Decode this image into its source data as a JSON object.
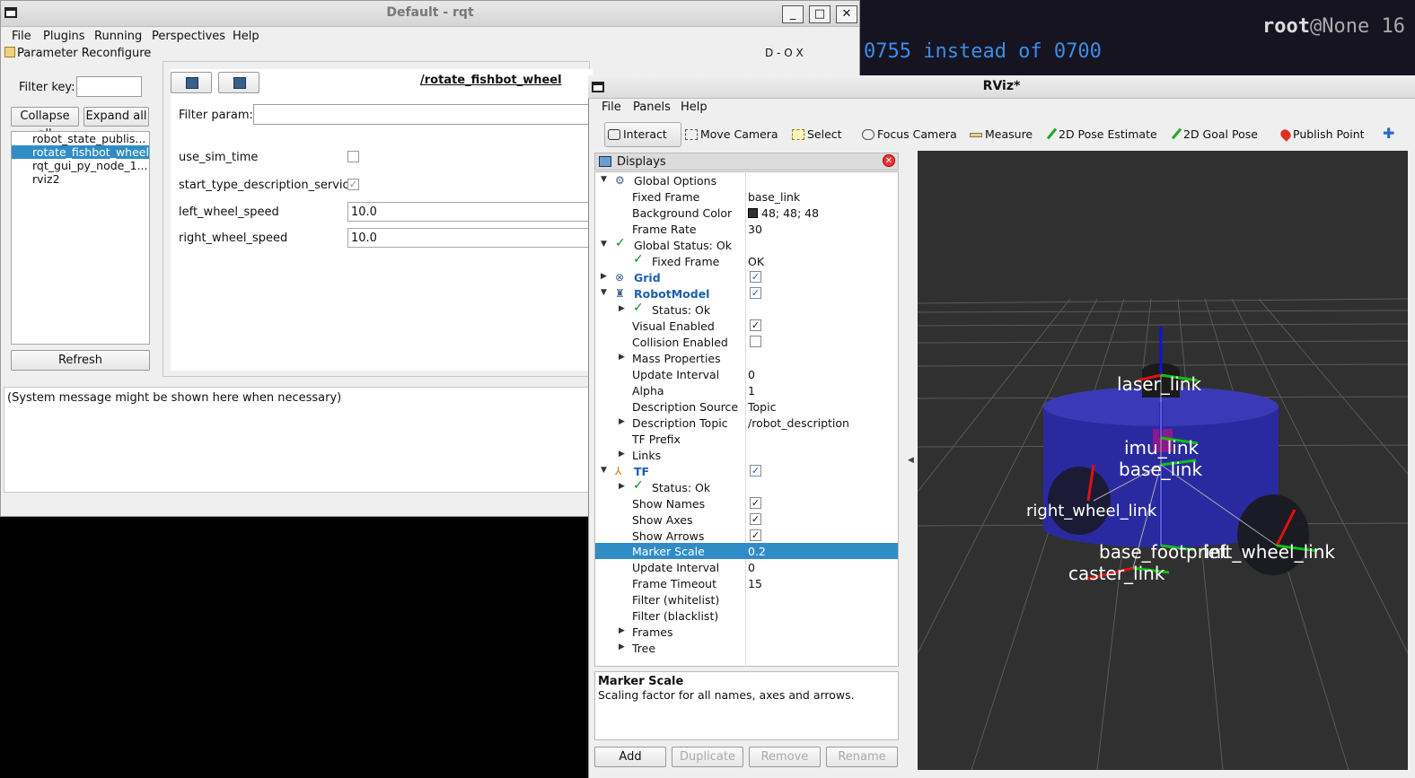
{
  "terminal": {
    "line1_user": "root",
    "line1_at": "@None 16",
    "line2": "0755 instead of 0700"
  },
  "rqt": {
    "title": "Default - rqt",
    "buttons": {
      "minimize": "_",
      "maximize": "□",
      "close": "✕"
    },
    "menu": [
      "File",
      "Plugins",
      "Running",
      "Perspectives",
      "Help"
    ],
    "plugin_title": "Parameter Reconfigure",
    "dock_controls": "D  - O X",
    "filter_key_label": "Filter key:",
    "filter_key_value": "",
    "collapse_all": "Collapse all",
    "expand_all": "Expand all",
    "nodes": [
      "robot_state_publis...",
      "rotate_fishbot_wheel",
      "rqt_gui_py_node_1...",
      "rviz2"
    ],
    "selected_node_index": 1,
    "refresh": "Refresh",
    "node_title": "/rotate_fishbot_wheel",
    "filter_param_label": "Filter param:",
    "filter_param_value": "",
    "params": [
      {
        "name": "use_sim_time",
        "type": "bool",
        "value": false
      },
      {
        "name": "start_type_description_service",
        "type": "bool",
        "value": true
      },
      {
        "name": "left_wheel_speed",
        "type": "text",
        "value": "10.0"
      },
      {
        "name": "right_wheel_speed",
        "type": "text",
        "value": "10.0"
      }
    ],
    "system_message": "(System message might be shown here when necessary)"
  },
  "rviz": {
    "title": "RViz*",
    "menu": [
      "File",
      "Panels",
      "Help"
    ],
    "tools": [
      "Interact",
      "Move Camera",
      "Select",
      "Focus Camera",
      "Measure",
      "2D Pose Estimate",
      "2D Goal Pose",
      "Publish Point"
    ],
    "active_tool": "Interact",
    "displays_title": "Displays",
    "tree": {
      "global_options": "Global Options",
      "fixed_frame_label": "Fixed Frame",
      "fixed_frame_value": "base_link",
      "bg_color_label": "Background Color",
      "bg_color_value": "48; 48; 48",
      "bg_color_hex": "#303030",
      "frame_rate_label": "Frame Rate",
      "frame_rate_value": "30",
      "global_status": "Global Status: Ok",
      "fixed_frame_status_label": "Fixed Frame",
      "fixed_frame_status_value": "OK",
      "grid": "Grid",
      "robot_model": "RobotModel",
      "status_ok": "Status: Ok",
      "visual_enabled": "Visual Enabled",
      "collision_enabled": "Collision Enabled",
      "mass_properties": "Mass Properties",
      "update_interval": "Update Interval",
      "update_interval_value": "0",
      "alpha": "Alpha",
      "alpha_value": "1",
      "description_source": "Description Source",
      "description_source_value": "Topic",
      "description_topic": "Description Topic",
      "description_topic_value": "/robot_description",
      "tf_prefix": "TF Prefix",
      "links": "Links",
      "tf": "TF",
      "tf_status": "Status: Ok",
      "show_names": "Show Names",
      "show_axes": "Show Axes",
      "show_arrows": "Show Arrows",
      "marker_scale": "Marker Scale",
      "marker_scale_value": "0.2",
      "tf_update_interval": "Update Interval",
      "tf_update_interval_value": "0",
      "frame_timeout": "Frame Timeout",
      "frame_timeout_value": "15",
      "filter_whitelist": "Filter (whitelist)",
      "filter_blacklist": "Filter (blacklist)",
      "frames": "Frames",
      "tree_node": "Tree"
    },
    "desc_title": "Marker Scale",
    "desc_text": "Scaling factor for all names, axes and arrows.",
    "bottom_buttons": [
      "Add",
      "Duplicate",
      "Remove",
      "Rename"
    ],
    "frame_labels": [
      "laser_link",
      "imu_link",
      "base_link",
      "right_wheel_link",
      "base_footprint",
      "left_wheel_link",
      "caster_link"
    ],
    "colors": {
      "robot_body": "#2a2aa0",
      "axis_x": "#e01010",
      "axis_y": "#10c010",
      "axis_z": "#1010e0",
      "selection": "#308cc6"
    }
  }
}
